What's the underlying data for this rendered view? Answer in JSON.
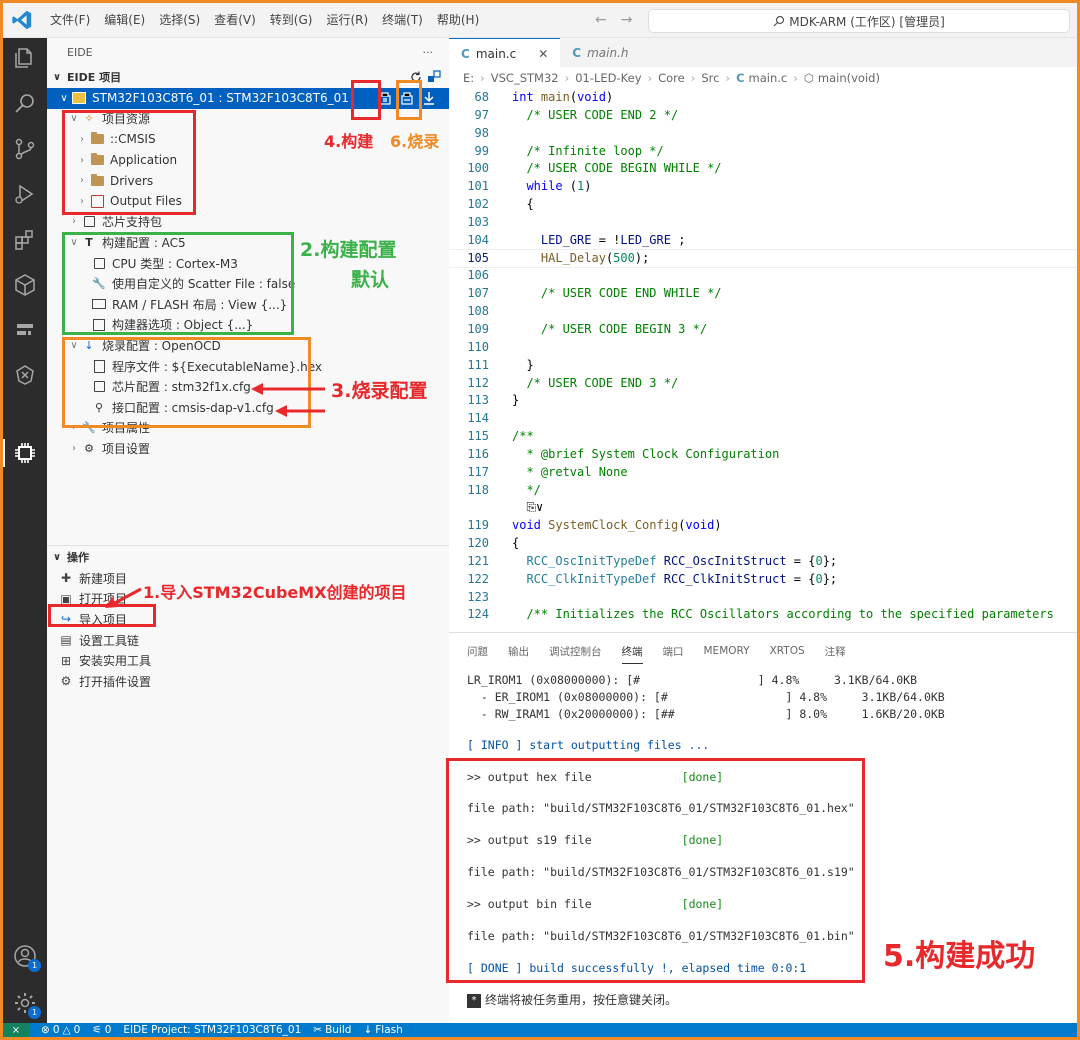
{
  "window": {
    "menu": [
      "文件(F)",
      "编辑(E)",
      "选择(S)",
      "查看(V)",
      "转到(G)",
      "运行(R)",
      "终端(T)",
      "帮助(H)"
    ],
    "search_text": "MDK-ARM (工作区) [管理员]"
  },
  "sidebar": {
    "header_title": "EIDE",
    "more_label": "···",
    "project_section": "EIDE 项目",
    "project_name": "STM32F103C8T6_01 : STM32F103C8T6_01",
    "resources_label": "项目资源",
    "resources": [
      "::CMSIS",
      "Application",
      "Drivers",
      "Output Files"
    ],
    "chip_pack": "芯片支持包",
    "build_config": "构建配置 : AC5",
    "build_items": [
      "CPU 类型 : Cortex-M3",
      "使用自定义的 Scatter File : false",
      "RAM / FLASH 布局 : View {...}",
      "构建器选项 : Object {...}"
    ],
    "flash_config": "烧录配置 : OpenOCD",
    "flash_items": [
      "程序文件 : ${ExecutableName}.hex",
      "芯片配置 : stm32f1x.cfg",
      "接口配置 : cmsis-dap-v1.cfg"
    ],
    "project_attrs": "项目属性",
    "project_settings": "项目设置",
    "ops_title": "操作",
    "ops": [
      "新建项目",
      "打开项目",
      "导入项目",
      "设置工具链",
      "安装实用工具",
      "打开插件设置"
    ]
  },
  "annotations": {
    "build": "4.构建",
    "flash": "6.烧录",
    "build_config": "2.构建配置",
    "build_default": "默认",
    "flash_config": "3.烧录配置",
    "import": "1.导入STM32CubeMX创建的项目",
    "success": "5.构建成功"
  },
  "editor": {
    "tabs": [
      {
        "name": "main.c",
        "close": "✕"
      },
      {
        "name": "main.h"
      }
    ],
    "breadcrumb": [
      "E:",
      "VSC_STM32",
      "01-LED-Key",
      "Core",
      "Src",
      "main.c",
      "main(void)"
    ],
    "lines": [
      {
        "n": "68",
        "t": "int main(void)"
      },
      {
        "n": "97",
        "t": "  /* USER CODE END 2 */"
      },
      {
        "n": "98",
        "t": ""
      },
      {
        "n": "99",
        "t": "  /* Infinite loop */"
      },
      {
        "n": "100",
        "t": "  /* USER CODE BEGIN WHILE */"
      },
      {
        "n": "101",
        "t": "  while (1)"
      },
      {
        "n": "102",
        "t": "  {"
      },
      {
        "n": "103",
        "t": ""
      },
      {
        "n": "104",
        "t": "    LED_GRE = !LED_GRE ;"
      },
      {
        "n": "105",
        "t": "    HAL_Delay(500);"
      },
      {
        "n": "106",
        "t": ""
      },
      {
        "n": "107",
        "t": "    /* USER CODE END WHILE */"
      },
      {
        "n": "108",
        "t": ""
      },
      {
        "n": "109",
        "t": "    /* USER CODE BEGIN 3 */"
      },
      {
        "n": "110",
        "t": ""
      },
      {
        "n": "111",
        "t": "  }"
      },
      {
        "n": "112",
        "t": "  /* USER CODE END 3 */"
      },
      {
        "n": "113",
        "t": "}"
      },
      {
        "n": "114",
        "t": ""
      },
      {
        "n": "115",
        "t": "/**"
      },
      {
        "n": "116",
        "t": "  * @brief System Clock Configuration"
      },
      {
        "n": "117",
        "t": "  * @retval None"
      },
      {
        "n": "118",
        "t": "  */"
      },
      {
        "n": "",
        "t": "  ⎘∨"
      },
      {
        "n": "119",
        "t": "void SystemClock_Config(void)"
      },
      {
        "n": "120",
        "t": "{"
      },
      {
        "n": "121",
        "t": "  RCC_OscInitTypeDef RCC_OscInitStruct = {0};"
      },
      {
        "n": "122",
        "t": "  RCC_ClkInitTypeDef RCC_ClkInitStruct = {0};"
      },
      {
        "n": "123",
        "t": ""
      },
      {
        "n": "124",
        "t": "  /** Initializes the RCC Oscillators according to the specified parameters"
      }
    ],
    "current_line": "105"
  },
  "panel": {
    "tabs": [
      "问题",
      "输出",
      "调试控制台",
      "终端",
      "端口",
      "MEMORY",
      "XRTOS",
      "注释"
    ],
    "active_tab": "终端",
    "mem_lines": [
      "LR_IROM1 (0x08000000): [#                 ] 4.8%     3.1KB/64.0KB",
      "  - ER_IROM1 (0x08000000): [#                 ] 4.8%     3.1KB/64.0KB",
      "  - RW_IRAM1 (0x20000000): [##                ] 8.0%     1.6KB/20.0KB"
    ],
    "info_tag": "[ INFO ]",
    "info_text": " start outputting files ...",
    "outputs": [
      {
        "label": ">> output hex file             ",
        "status": "[done]",
        "path": "file path: \"build/STM32F103C8T6_01/STM32F103C8T6_01.hex\""
      },
      {
        "label": ">> output s19 file             ",
        "status": "[done]",
        "path": "file path: \"build/STM32F103C8T6_01/STM32F103C8T6_01.s19\""
      },
      {
        "label": ">> output bin file             ",
        "status": "[done]",
        "path": "file path: \"build/STM32F103C8T6_01/STM32F103C8T6_01.bin\""
      }
    ],
    "done_tag": "[ DONE ]",
    "done_text": " build successfully !, elapsed time 0:0:1",
    "reuse_icon": "*",
    "reuse_msg": "终端将被任务重用，按任意键关闭。"
  },
  "statusbar": {
    "remote": "⨯",
    "errors": "0",
    "warnings": "0",
    "ports": "0",
    "project": "EIDE Project: STM32F103C8T6_01",
    "build": "Build",
    "flash": "Flash"
  },
  "activity_badges": [
    "1",
    "1"
  ],
  "colors": {
    "accent": "#007acc",
    "red": "#e8282b",
    "green": "#3bb14a",
    "orange": "#f08a24"
  }
}
